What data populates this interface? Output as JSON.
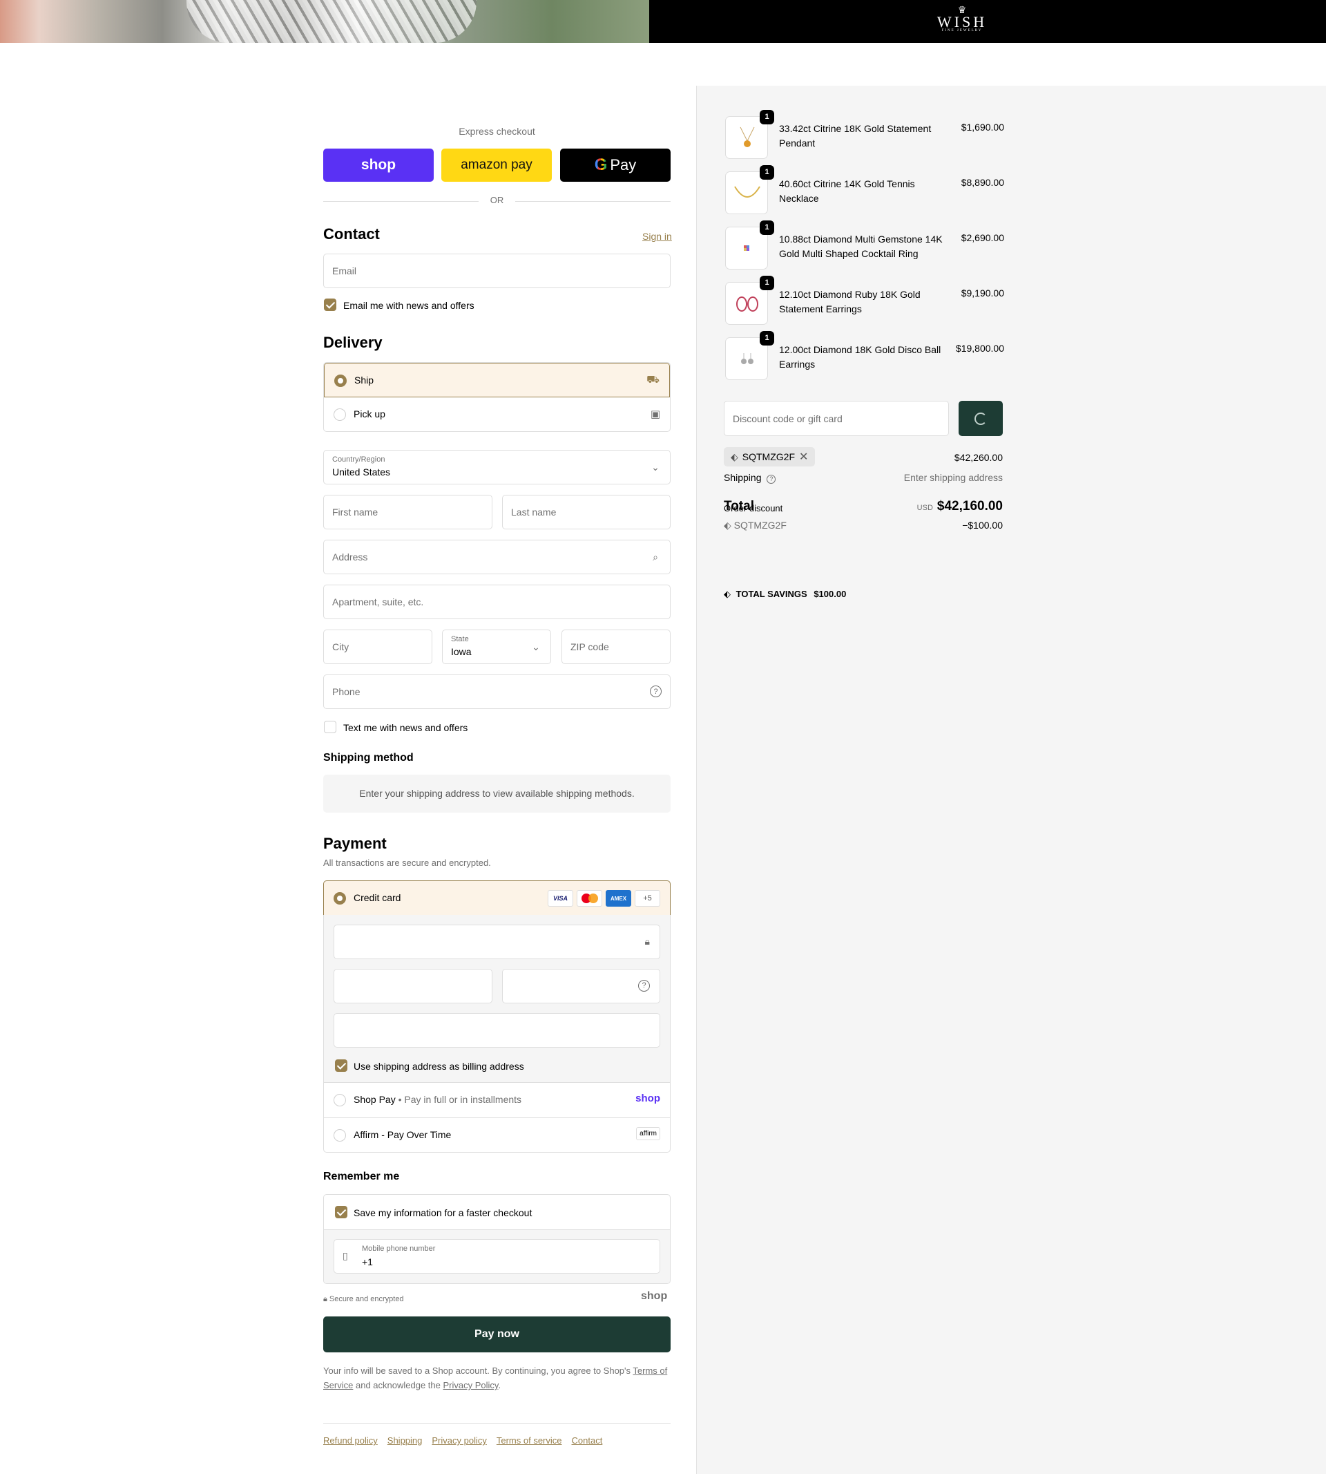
{
  "header": {
    "logo_word": "WISH",
    "logo_sub": "FINE JEWELRY"
  },
  "express": {
    "title": "Express checkout",
    "shop_label": "shop",
    "amazon_label": "amazon pay",
    "gpay_label": "Pay",
    "or": "OR"
  },
  "contact": {
    "title": "Contact",
    "sign_in": "Sign in",
    "email_placeholder": "Email",
    "news_label": "Email me with news and offers",
    "news_checked": true
  },
  "delivery": {
    "title": "Delivery",
    "options": [
      {
        "label": "Ship",
        "selected": true,
        "icon": "truck-icon"
      },
      {
        "label": "Pick up",
        "selected": false,
        "icon": "store-icon"
      }
    ],
    "country_label": "Country/Region",
    "country_value": "United States",
    "first_name": "First name",
    "last_name": "Last name",
    "address": "Address",
    "apartment": "Apartment, suite, etc.",
    "city": "City",
    "state_label": "State",
    "state_value": "Iowa",
    "zip": "ZIP code",
    "phone": "Phone",
    "text_label": "Text me with news and offers"
  },
  "shipping_method": {
    "title": "Shipping method",
    "empty": "Enter your shipping address to view available shipping methods."
  },
  "payment": {
    "title": "Payment",
    "subtitle": "All transactions are secure and encrypted.",
    "credit_card": "Credit card",
    "card_brands": [
      "VISA",
      "MC",
      "AMEX",
      "+5"
    ],
    "billing_label": "Use shipping address as billing address",
    "shop_pay": "Shop Pay",
    "shop_pay_note": "Pay in full or in installments",
    "shop_pay_logo": "shop",
    "affirm": "Affirm - Pay Over Time",
    "affirm_logo": "affirm"
  },
  "remember": {
    "title": "Remember me",
    "save_label": "Save my information for a faster checkout",
    "mobile_label": "Mobile phone number",
    "mobile_value": "+1",
    "secure": "Secure and encrypted",
    "shop_logo": "shop"
  },
  "pay_now": "Pay now",
  "legal": {
    "pre": "Your info will be saved to a Shop account. By continuing, you agree to Shop's",
    "tos": "Terms of Service",
    "mid": "and acknowledge the",
    "privacy": "Privacy Policy",
    "end": "."
  },
  "footer": [
    "Refund policy",
    "Shipping",
    "Privacy policy",
    "Terms of service",
    "Contact"
  ],
  "cart": {
    "items": [
      {
        "qty": "1",
        "name": "33.42ct Citrine 18K Gold Statement Pendant",
        "price": "$1,690.00"
      },
      {
        "qty": "1",
        "name": "40.60ct Citrine 14K Gold Tennis Necklace",
        "price": "$8,890.00"
      },
      {
        "qty": "1",
        "name": "10.88ct Diamond Multi Gemstone 14K Gold Multi Shaped Cocktail Ring",
        "price": "$2,690.00"
      },
      {
        "qty": "1",
        "name": "12.10ct Diamond Ruby 18K Gold Statement Earrings",
        "price": "$9,190.00"
      },
      {
        "qty": "1",
        "name": "12.00ct Diamond 18K Gold Disco Ball Earrings",
        "price": "$19,800.00"
      }
    ],
    "discount_placeholder": "Discount code or gift card",
    "applied_code": "SQTMZG2F",
    "subtotal": "$42,260.00",
    "shipping_label": "Shipping",
    "shipping_value": "Enter shipping address",
    "total_label": "Total",
    "order_discount_label": "Order discount",
    "currency": "USD",
    "total_value": "$42,160.00",
    "discount_code": "SQTMZG2F",
    "discount_amount": "−$100.00",
    "savings_label": "TOTAL SAVINGS",
    "savings_value": "$100.00"
  }
}
